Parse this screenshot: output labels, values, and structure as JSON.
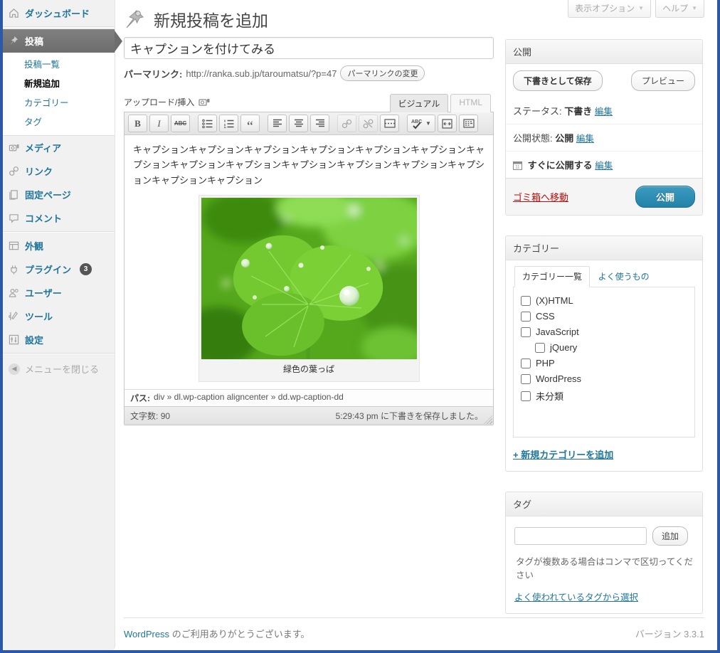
{
  "colors": {
    "accent_link": "#21759b",
    "publish_button": "#2282a8",
    "window_border": "#2d58a7",
    "trash_red": "#bc0b0b"
  },
  "topbar": {
    "screen_options": "表示オプション",
    "help": "ヘルプ"
  },
  "sidebar": {
    "items": [
      {
        "label": "ダッシュボード",
        "icon": "dashboard-icon"
      },
      {
        "label": "投稿",
        "icon": "pushpin-icon",
        "current": true
      },
      {
        "label": "投稿一覧"
      },
      {
        "label": "新規追加",
        "current_sub": true
      },
      {
        "label": "カテゴリー"
      },
      {
        "label": "タグ"
      },
      {
        "label": "メディア",
        "icon": "media-icon"
      },
      {
        "label": "リンク",
        "icon": "links-icon"
      },
      {
        "label": "固定ページ",
        "icon": "pages-icon"
      },
      {
        "label": "コメント",
        "icon": "comments-icon"
      },
      {
        "label": "外観",
        "icon": "appearance-icon"
      },
      {
        "label": "プラグイン",
        "icon": "plugins-icon",
        "badge": "3"
      },
      {
        "label": "ユーザー",
        "icon": "users-icon"
      },
      {
        "label": "ツール",
        "icon": "tools-icon"
      },
      {
        "label": "設定",
        "icon": "settings-icon"
      }
    ],
    "collapse_label": "メニューを閉じる"
  },
  "header": {
    "title": "新規投稿を追加"
  },
  "title_field": {
    "value": "キャプションを付けてみる"
  },
  "permalink": {
    "label": "パーマリンク:",
    "url": "http://ranka.sub.jp/taroumatsu/?p=47",
    "change_button": "パーマリンクの変更"
  },
  "editor": {
    "upload_insert": "アップロード/挿入",
    "tabs": {
      "visual": "ビジュアル",
      "html": "HTML"
    },
    "toolbar": {
      "bold": "B",
      "italic": "I",
      "strike": "ABC",
      "spell": "ABC"
    },
    "content_text": "キャプションキャプションキャプションキャプションキャプションキャプションキャプションキャプションキャプションキャプションキャプションキャプションキャプションキャプションキャプション",
    "image_caption": "緑色の葉っぱ",
    "path": {
      "label": "パス:",
      "value": "div » dl.wp-caption aligncenter » dd.wp-caption-dd"
    },
    "wordcount_label": "文字数:",
    "wordcount": "90",
    "autosave": "5:29:43 pm に下書きを保存しました。"
  },
  "publish_box": {
    "title": "公開",
    "save_draft": "下書きとして保存",
    "preview": "プレビュー",
    "status_label": "ステータス:",
    "status_value": "下書き",
    "edit": "編集",
    "visibility_label": "公開状態:",
    "visibility_value": "公開",
    "schedule_text": "すぐに公開する",
    "trash": "ゴミ箱へ移動",
    "publish_button": "公開"
  },
  "categories_box": {
    "title": "カテゴリー",
    "tab_all": "カテゴリー一覧",
    "tab_popular": "よく使うもの",
    "items": [
      {
        "label": "(X)HTML"
      },
      {
        "label": "CSS"
      },
      {
        "label": "JavaScript"
      },
      {
        "label": "jQuery",
        "indent": 1
      },
      {
        "label": "PHP"
      },
      {
        "label": "WordPress"
      },
      {
        "label": "未分類"
      }
    ],
    "add_new": "+ 新規カテゴリーを追加"
  },
  "tags_box": {
    "title": "タグ",
    "add_button": "追加",
    "help": "タグが複数ある場合はコンマで区切ってください",
    "choose_link": "よく使われているタグから選択"
  },
  "footer": {
    "thanks_link": "WordPress",
    "thanks_rest": "のご利用ありがとうございます。",
    "version": "バージョン 3.3.1"
  }
}
